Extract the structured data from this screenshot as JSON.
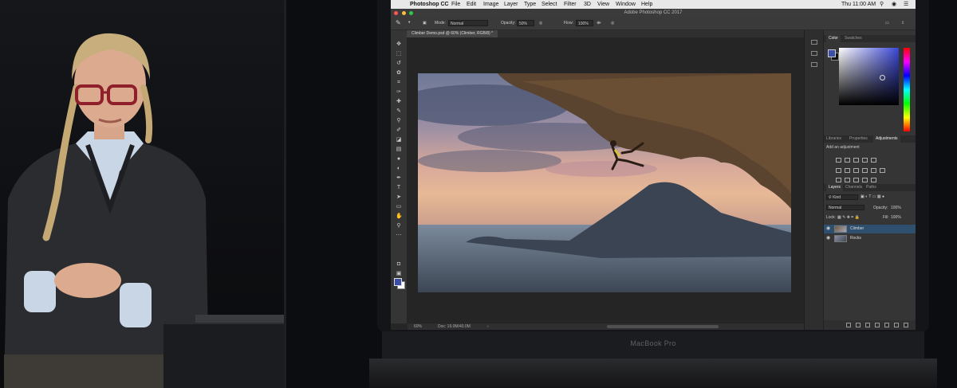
{
  "macos_menu": {
    "apple_icon": "apple-logo",
    "app": "Photoshop CC",
    "items": [
      "File",
      "Edit",
      "Image",
      "Layer",
      "Type",
      "Select",
      "Filter",
      "3D",
      "View",
      "Window",
      "Help"
    ],
    "clock": "Thu 11:00 AM"
  },
  "window": {
    "title": "Adobe Photoshop CC 2017"
  },
  "options_bar": {
    "mode_label": "Mode:",
    "mode_value": "Normal",
    "opacity_label": "Opacity:",
    "opacity_value": "50%",
    "flow_label": "Flow:",
    "flow_value": "100%"
  },
  "document_tab": "Climber Demo.psd @ 60% (Climber, RGB/8) *",
  "status_bar": {
    "zoom": "60%",
    "doc": "Doc: 19.0M/40.0M"
  },
  "color_panel": {
    "tabs": [
      "Color",
      "Swatches"
    ],
    "foreground": "#3c4fa8",
    "background": "#111111"
  },
  "adjustments_panel": {
    "tabs": [
      "Libraries",
      "Properties",
      "Adjustments"
    ],
    "heading": "Add an adjustment"
  },
  "layers_panel": {
    "tabs": [
      "Layers",
      "Channels",
      "Paths"
    ],
    "filter_value": "Kind",
    "blend_value": "Normal",
    "opacity_label": "Opacity:",
    "opacity_value": "100%",
    "lock_label": "Lock:",
    "fill_label": "Fill:",
    "fill_value": "100%",
    "layers": [
      {
        "name": "Climber",
        "selected": true
      },
      {
        "name": "Rocks",
        "selected": false
      }
    ]
  },
  "device": {
    "brand": "MacBook Pro"
  }
}
